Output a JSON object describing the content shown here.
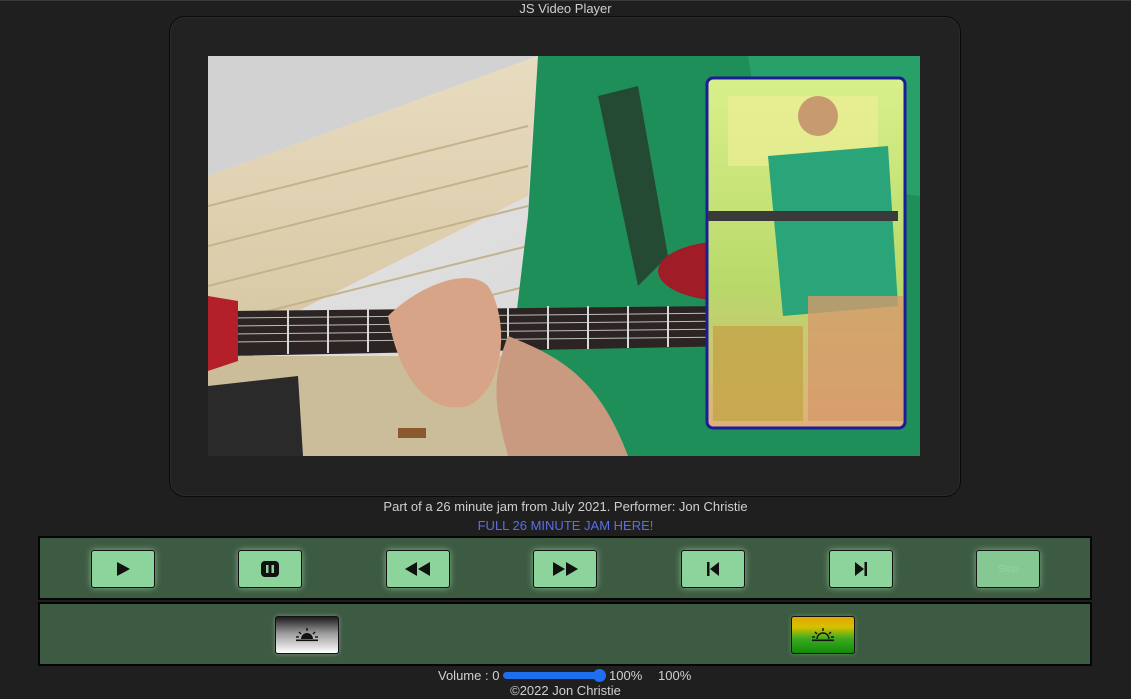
{
  "window": {
    "title": "JS Video Player"
  },
  "video": {
    "caption": "Part of a 26 minute jam from July 2021. Performer: Jon Christie"
  },
  "link": {
    "label": "FULL 26 MINUTE JAM HERE!"
  },
  "controls": {
    "play": "play-icon",
    "pause": "pause-icon",
    "rewind": "rewind-icon",
    "fast_forward": "fast-forward-icon",
    "previous": "skip-previous-icon",
    "next": "skip-next-icon",
    "disabled_label": "Stop"
  },
  "filters": {
    "left": "sunset-icon",
    "right": "sunset-icon"
  },
  "volume": {
    "label": "Volume : 0",
    "level_percent": "100%",
    "value_percent": "100%",
    "level": 1.0
  },
  "footer": {
    "text": "©2022 Jon Christie"
  },
  "colors": {
    "panel": "#3d5a42",
    "button": "#8dd49c",
    "link": "#5b6fe6",
    "slider": "#1e6ef0"
  }
}
